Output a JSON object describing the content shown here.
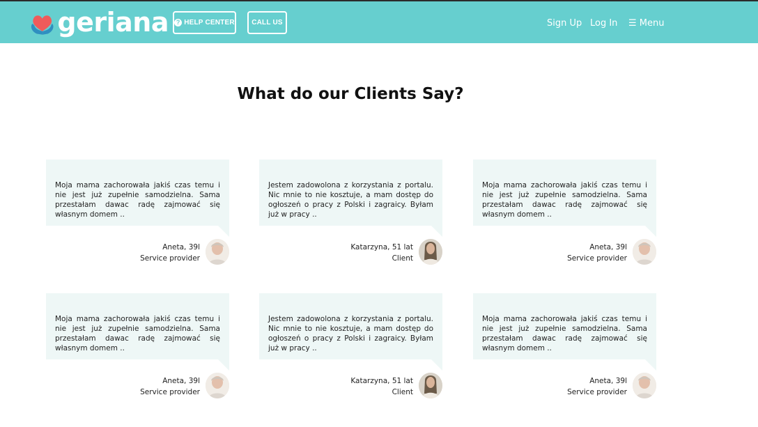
{
  "header": {
    "logo_text": "geriana",
    "help_center_label": "HELP CENTER",
    "call_us_label": "CALL US",
    "sign_up_label": "Sign Up",
    "log_in_label": "Log In",
    "menu_label": "☰ Menu"
  },
  "main": {
    "title": "What do our Clients Say?"
  },
  "testimonials": [
    {
      "text": "Moja mama zachorowała jakiś czas temu i nie jest już zupełnie samodzielna. Sama przestałam dawac radę zajmować się własnym domem ..",
      "name": "Aneta, 39l",
      "role": "Service provider",
      "avatar": "woman-portrait"
    },
    {
      "text": "Jestem zadowolona z korzystania z portalu. Nic mnie to nie kosztuje, a mam dostęp do ogłoszeń o pracy z Polski i zagraicy. Byłam już w pracy ..",
      "name": "Katarzyna, 51 lat",
      "role": "Client",
      "avatar": "woman-portrait-dark"
    },
    {
      "text": "Moja mama zachorowała jakiś czas temu i nie jest już zupełnie samodzielna. Sama przestałam dawac radę zajmować się własnym domem ..",
      "name": "Aneta, 39l",
      "role": "Service provider",
      "avatar": "woman-portrait"
    },
    {
      "text": "Moja mama zachorowała jakiś czas temu i nie jest już zupełnie samodzielna. Sama przestałam dawac radę zajmować się własnym domem ..",
      "name": "Aneta, 39l",
      "role": "Service provider",
      "avatar": "woman-portrait"
    },
    {
      "text": "Jestem zadowolona z korzystania z portalu. Nic mnie to nie kosztuje, a mam dostęp do ogłoszeń o pracy z Polski i zagraicy. Byłam już w pracy ..",
      "name": "Katarzyna, 51 lat",
      "role": "Client",
      "avatar": "woman-portrait-dark"
    },
    {
      "text": "Moja mama zachorowała jakiś czas temu i nie jest już zupełnie samodzielna. Sama przestałam dawac radę zajmować się własnym domem ..",
      "name": "Aneta, 39l",
      "role": "Service provider",
      "avatar": "woman-portrait"
    }
  ],
  "colors": {
    "header_bg": "#66cfcf",
    "card_bg": "#eef7f6",
    "logo_heart": "#ef5b5b",
    "logo_hands": "#2f8fc0"
  }
}
